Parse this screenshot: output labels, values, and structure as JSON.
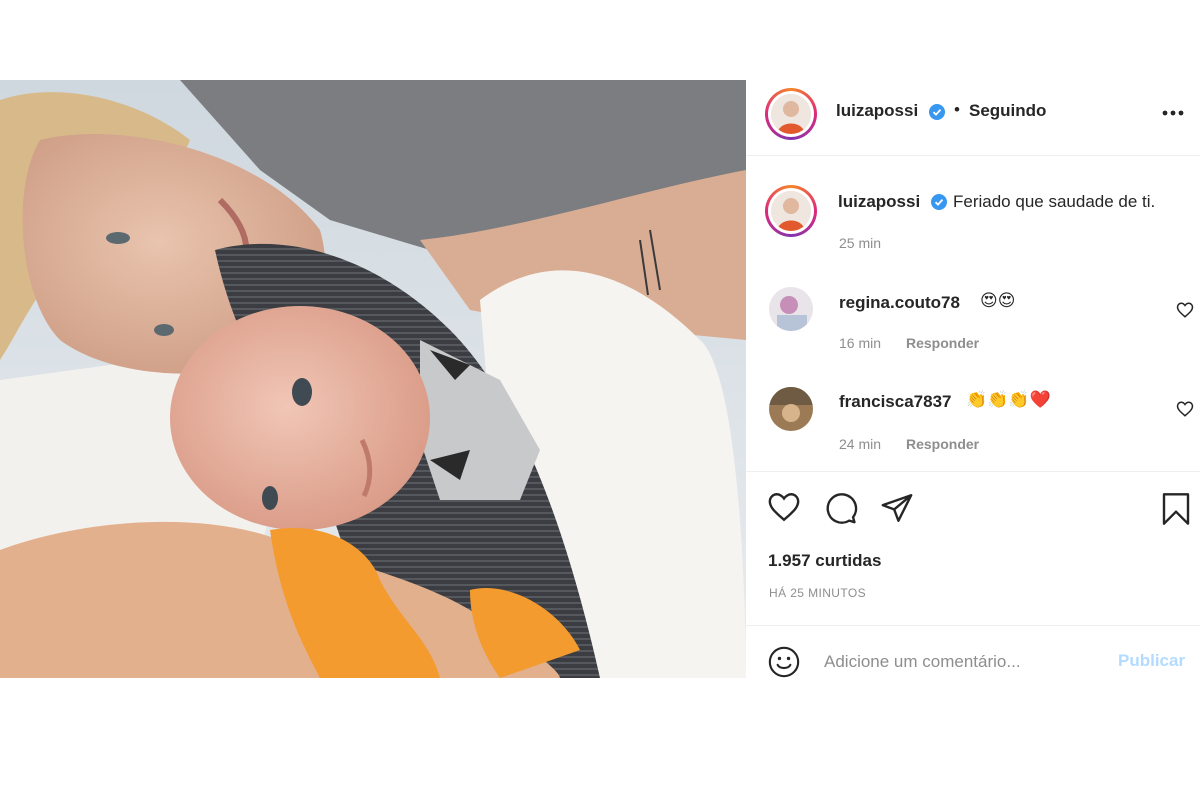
{
  "post": {
    "author": "luizapossi",
    "verified": true,
    "separator": "•",
    "follow_status": "Seguindo",
    "more_icon": "more-horizontal-icon",
    "caption": "Feriado que saudade de ti.",
    "caption_time": "25 min",
    "likes": "1.957 curtidas",
    "posted_ago": "HÁ 25 MINUTOS"
  },
  "comments": [
    {
      "username": "regina.couto78",
      "text": "😍😍",
      "time": "16 min",
      "reply_label": "Responder"
    },
    {
      "username": "francisca7837",
      "text": "👏👏👏❤️",
      "time": "24 min",
      "reply_label": "Responder"
    }
  ],
  "actions": {
    "like_icon": "heart-icon",
    "comment_icon": "comment-icon",
    "share_icon": "paper-plane-icon",
    "save_icon": "bookmark-icon"
  },
  "comment_box": {
    "placeholder": "Adicione um comentário...",
    "publish_label": "Publicar",
    "emoji_icon": "smiley-icon"
  },
  "colors": {
    "verified_blue": "#3897f0",
    "publish_disabled": "#b3dbff",
    "secondary_text": "#8e8e8e"
  }
}
